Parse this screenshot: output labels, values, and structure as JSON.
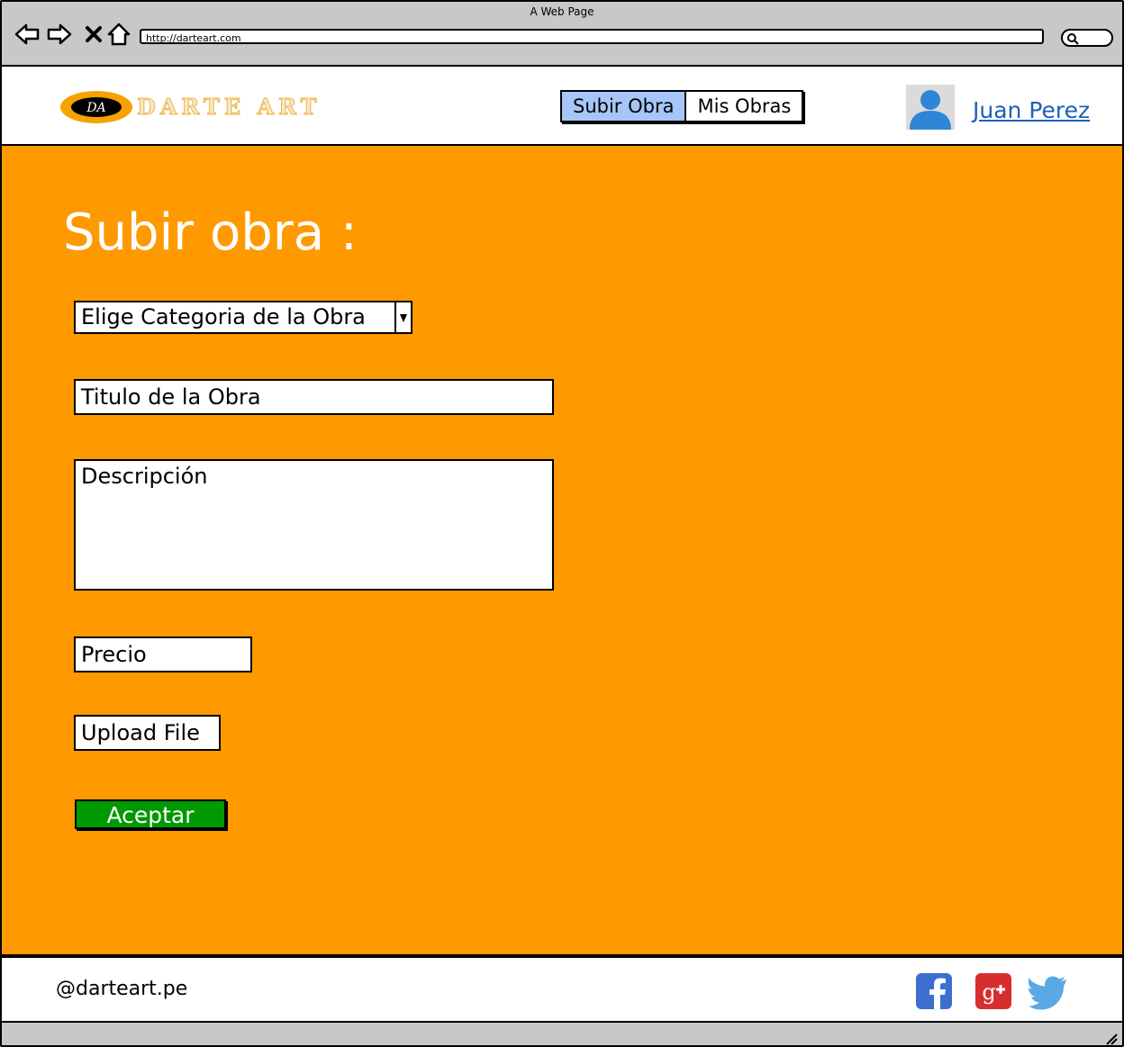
{
  "browser": {
    "window_title": "A Web Page",
    "url": "http://darteart.com"
  },
  "header": {
    "logo_monogram": "DA",
    "logo_text": "DARTE ART",
    "nav": [
      {
        "label": "Subir Obra",
        "active": true
      },
      {
        "label": "Mis Obras",
        "active": false
      }
    ],
    "user_name": "Juan Perez"
  },
  "main": {
    "title": "Subir obra :",
    "category_select": "Elige Categoria de la Obra",
    "title_field": "Titulo de la Obra",
    "description_field": "Descripción",
    "price_field": "Precio",
    "upload_button": "Upload File",
    "accept_button": "Aceptar"
  },
  "footer": {
    "handle": "@darteart.pe",
    "social_icons": [
      "facebook-icon",
      "google-plus-icon",
      "twitter-icon"
    ]
  },
  "colors": {
    "main_background": "#ff9900",
    "active_tab": "#a6c6f8",
    "accept_button": "#009900",
    "user_link": "#1f5fb7"
  }
}
